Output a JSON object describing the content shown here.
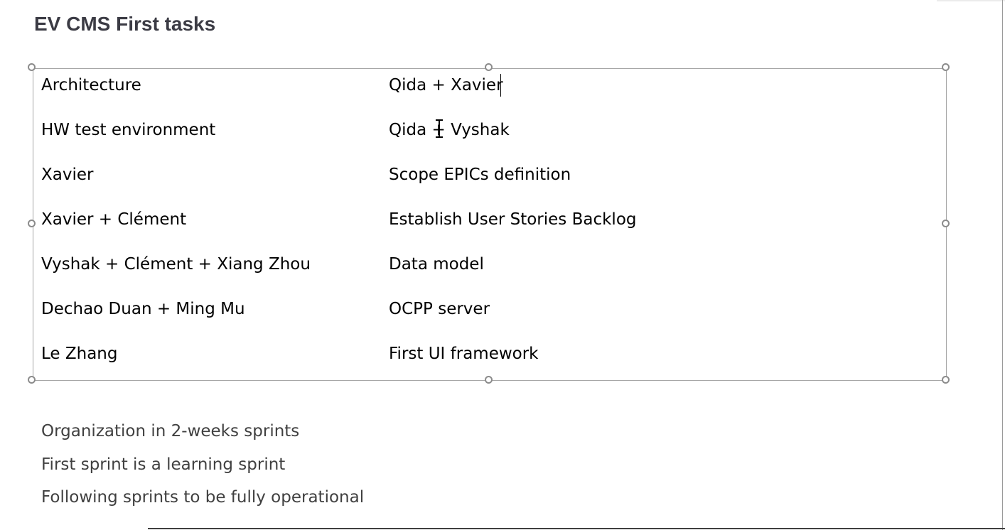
{
  "slide": {
    "title": "EV CMS First tasks",
    "table": {
      "rows": [
        {
          "left": "Architecture",
          "right": "Qida + Xavier"
        },
        {
          "left": "HW test environment",
          "right": "Qida + Vyshak"
        },
        {
          "left": "Xavier",
          "right": "Scope EPICs definition"
        },
        {
          "left": "Xavier + Clément",
          "right": "Establish User Stories Backlog"
        },
        {
          "left": "Vyshak + Clément + Xiang Zhou",
          "right": "Data model"
        },
        {
          "left": "Dechao Duan + Ming Mu",
          "right": "OCPP server"
        },
        {
          "left": "Le Zhang",
          "right": "First UI framework"
        }
      ]
    },
    "bullets": [
      "Organization in 2-weeks sprints",
      "First sprint is a learning sprint",
      "Following sprints to be fully operational"
    ]
  },
  "colors": {
    "title": "#3b3b44",
    "table_border": "#a6a6a6",
    "handle": "#8c8c8c",
    "body_text": "#404040"
  },
  "icons": [
    "selection-handle-icon",
    "text-cursor-icon",
    "i-beam-pointer-icon"
  ]
}
